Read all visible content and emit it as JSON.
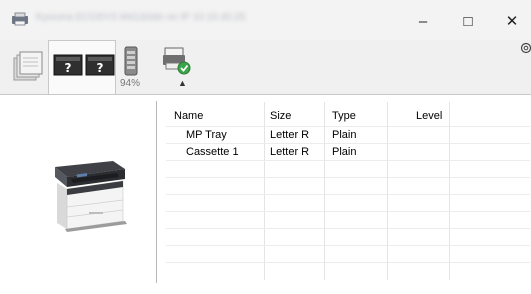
{
  "window": {
    "title": "Kyocera ECOSYS M4132idn on IP 10.10.40.25",
    "minimize": "–",
    "maximize": "□",
    "close": "✕"
  },
  "toolbar": {
    "toner_percent": "94%",
    "collapse_glyph": "▲"
  },
  "paper_list": {
    "columns": [
      "Name",
      "Size",
      "Type",
      "Level"
    ],
    "rows": [
      {
        "name": "MP Tray",
        "size": "Letter R",
        "type": "Plain",
        "level": ""
      },
      {
        "name": "Cassette 1",
        "size": "Letter R",
        "type": "Plain",
        "level": ""
      }
    ]
  },
  "icons": {
    "app": "printer-app-icon",
    "settings": "gear-icon",
    "tab1": "paper-stack-icon",
    "tab2": "help-icons",
    "tab3": "toner-icon",
    "tab4": "printer-ok-icon"
  }
}
